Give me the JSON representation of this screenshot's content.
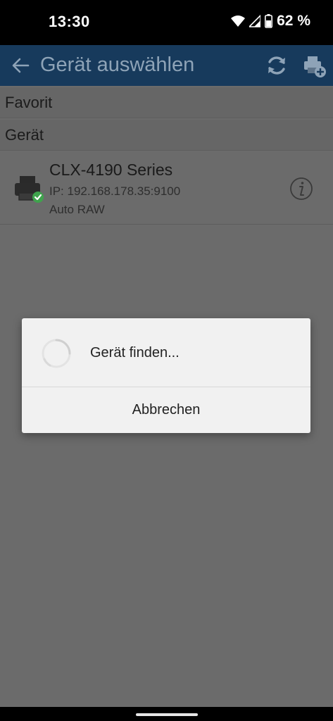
{
  "status_bar": {
    "time": "13:30",
    "battery": "62 %",
    "icons": [
      "wifi-icon",
      "cell-signal-icon",
      "battery-icon"
    ]
  },
  "app_bar": {
    "title": "Gerät auswählen",
    "icons": [
      "back-arrow-icon",
      "refresh-icon",
      "add-printer-icon"
    ],
    "color": "#173a5c"
  },
  "list": {
    "sections": {
      "favorite": "Favorit",
      "device": "Gerät"
    },
    "devices": [
      {
        "name": "CLX-4190 Series",
        "ip": "IP: 192.168.178.35:9100",
        "mode": "Auto RAW",
        "icons": [
          "printer-icon",
          "checkmark-badge-icon",
          "info-icon"
        ]
      }
    ]
  },
  "dialog": {
    "message": "Gerät finden...",
    "cancel_label": "Abbrechen",
    "icon": "loading-spinner-icon"
  },
  "colors": {
    "scrim": "#6b6b6b",
    "check_green": "#3fa34d"
  }
}
